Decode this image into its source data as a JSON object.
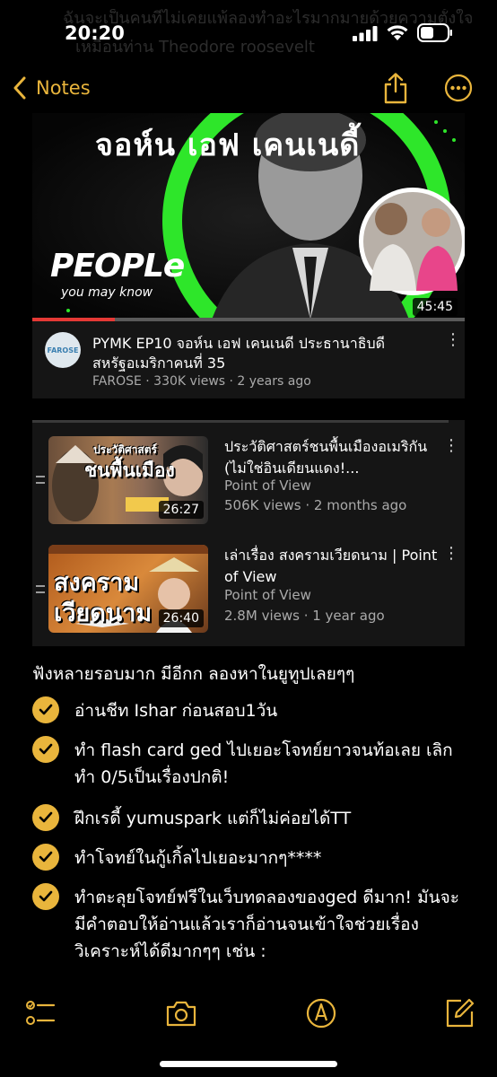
{
  "status_bar": {
    "time": "20:20",
    "ghost_line1": "ฉันจะเป็นคนที่ไม่เคยแพ้ลองทำอะไรมากมายด้วยความตั้งใจ",
    "ghost_line2": "เหมือนท่าน Theodore roosevelt"
  },
  "nav": {
    "back_label": "Notes"
  },
  "video1": {
    "thumb_title": "จอห์น เอฟ เคนเนดี้",
    "logo": "PEOPLe",
    "logo_sub": "you may know",
    "duration": "45:45",
    "progress_percent": 19,
    "channel_avatar_text": "FAROSE",
    "title": "PYMK EP10 จอห์น เอฟ เคนเนดี ประธานาธิบดีสหรัฐอเมริกาคนที่ 35",
    "meta": "FAROSE · 330K views · 2 years ago"
  },
  "playlist": {
    "items": [
      {
        "thumb_small": "ประวัติศาสตร์",
        "thumb_big": "ชนพื้นเมือง",
        "duration": "26:27",
        "title": "ประวัติศาสตร์ชนพื้นเมืองอเมริกัน (ไม่ใช่อินเดียนแดง!...",
        "channel": "Point of View",
        "meta": "506K views · 2 months ago"
      },
      {
        "thumb_big1": "สงคราม",
        "thumb_big2": "เวียดนาม",
        "duration": "26:40",
        "title": "เล่าเรื่อง สงครามเวียดนาม | Point of View",
        "channel": "Point of View",
        "meta": "2.8M views · 1 year ago"
      }
    ]
  },
  "note": {
    "heading": "ฟังหลายรอบมาก มีอีกก ลองหาในยูทูปเลยๆๆ",
    "checklist": [
      "อ่านชีท Ishar ก่อนสอบ1วัน",
      "ทำ flash card ged ไปเยอะโจทย์ยาวจนท้อเลย เลิกทำ 0/5เป็นเรื่องปกติ!",
      "ฝึกเรดี้ yumuspark แต่ก็ไม่ค่อยได้TT",
      "ทำโจทย์ในกู้เกิ้ลไปเยอะมากๆ****",
      "ทำตะลุยโจทย์ฟรีในเว็บทดลองของged ดีมาก! มันจะมีคำตอบให้อ่านแล้วเราก็อ่านจนเข้าใจช่วยเรื่องวิเคราะห์ได้ดีมากๆๆ เช่น :"
    ]
  },
  "colors": {
    "accent": "#e9b53c",
    "background": "#000000",
    "card": "#151515",
    "progress": "#e53935"
  }
}
